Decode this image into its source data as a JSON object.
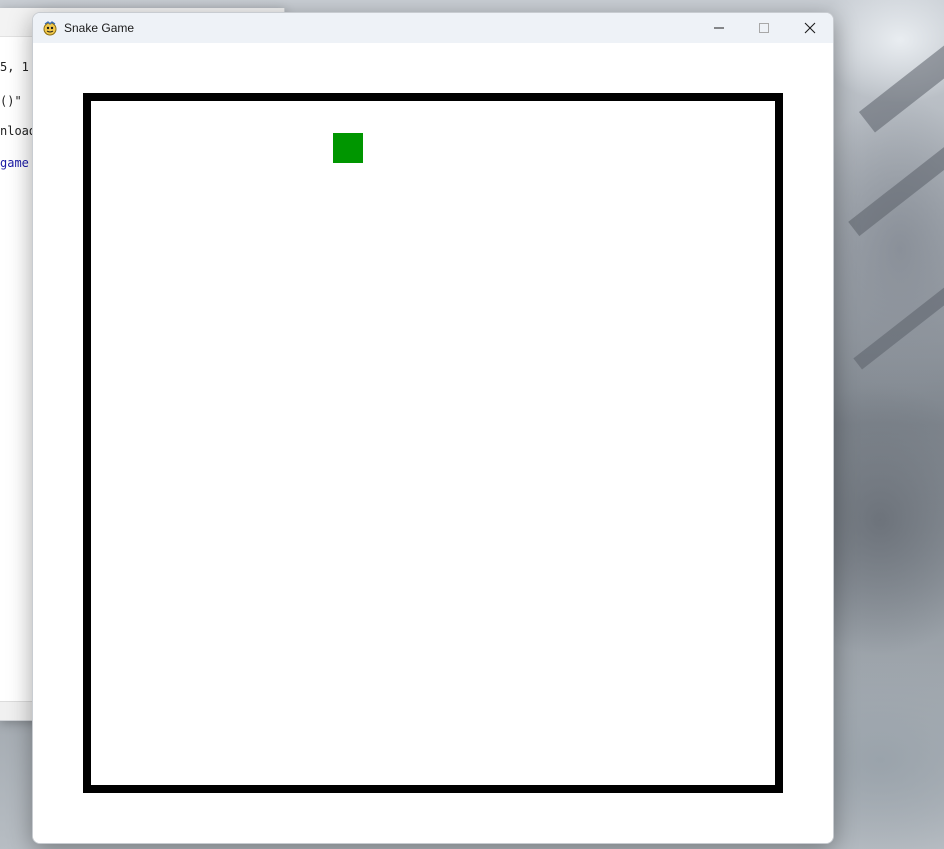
{
  "window": {
    "title": "Snake Game",
    "app_icon": "pygame-snake-icon",
    "controls": {
      "minimize_icon": "minimize-icon",
      "maximize_icon": "maximize-icon",
      "close_icon": "close-icon"
    }
  },
  "game": {
    "board_border_color": "#000000",
    "board_background": "#ffffff",
    "snake": {
      "color": "#009600",
      "segments": 1
    }
  },
  "background_editor": {
    "visible_code_fragments": [
      "5, 1",
      "()\" ",
      "nload",
      "game"
    ]
  }
}
